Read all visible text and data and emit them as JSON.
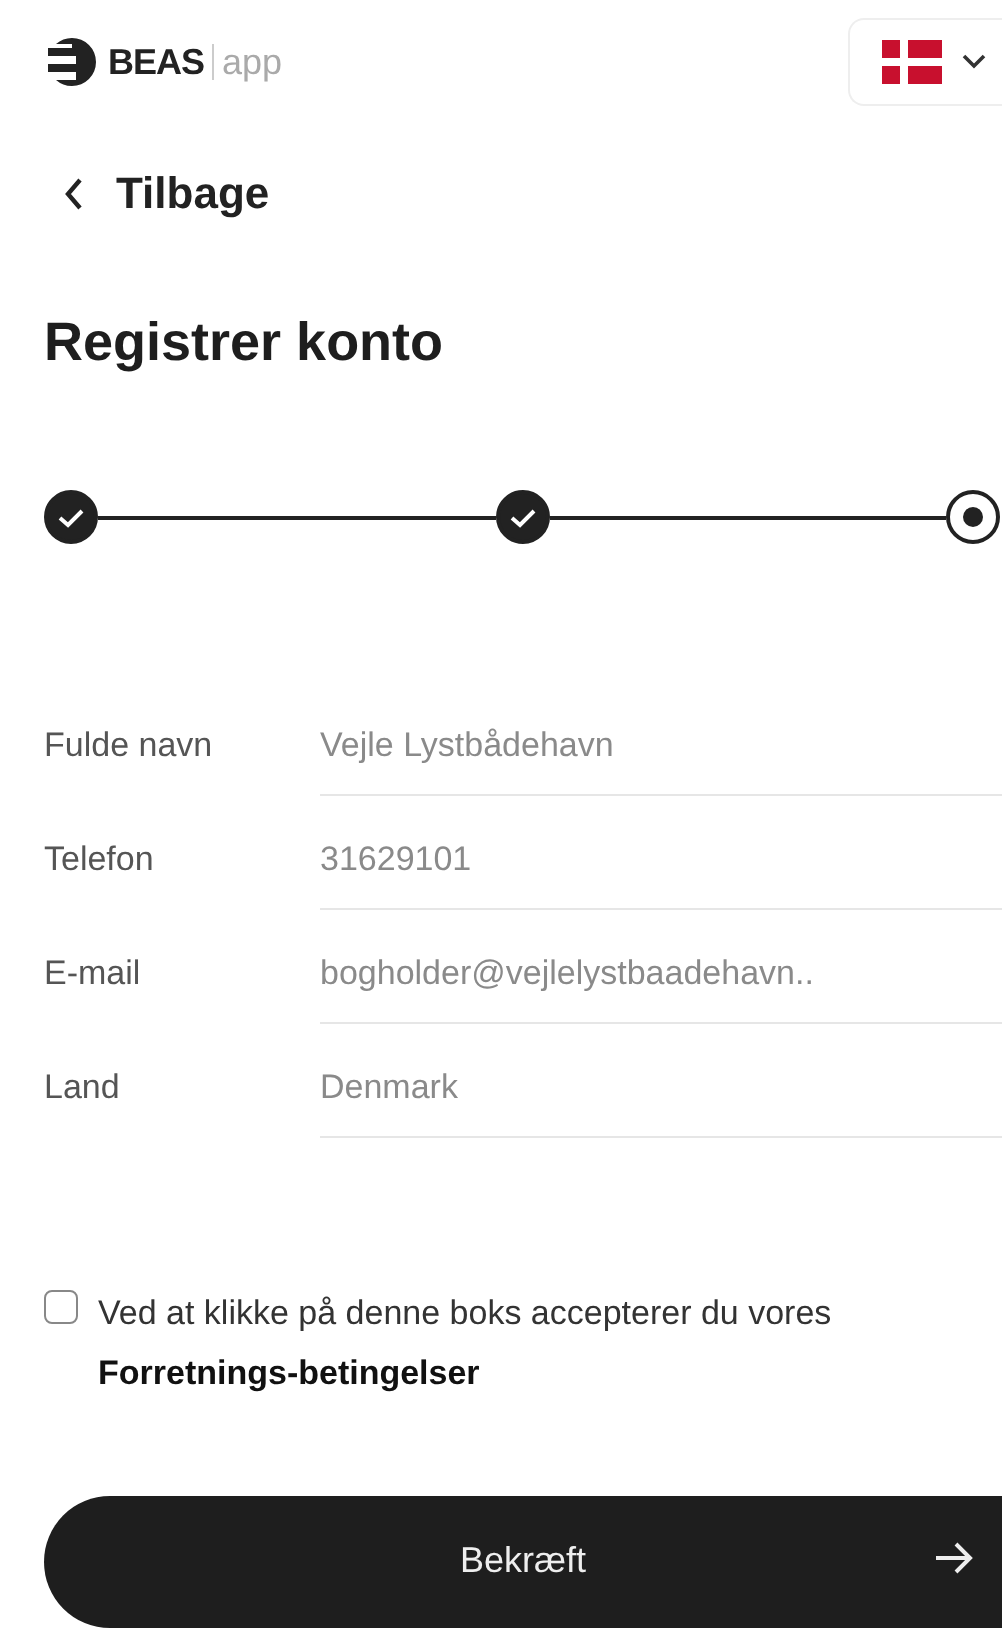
{
  "header": {
    "logo_text": "BEAS",
    "logo_suffix": "app"
  },
  "back": {
    "label": "Tilbage"
  },
  "title": "Registrer konto",
  "stepper": [
    {
      "completed": true,
      "selected": false
    },
    {
      "completed": true,
      "selected": false
    },
    {
      "completed": false,
      "selected": true
    }
  ],
  "fields": [
    {
      "label": "Fulde navn",
      "value": "Vejle Lystbådehavn"
    },
    {
      "label": "Telefon",
      "value": "31629101"
    },
    {
      "label": "E-mail",
      "value": "bogholder@vejlelystbaadehavn.."
    },
    {
      "label": "Land",
      "value": "Denmark"
    }
  ],
  "terms": {
    "checked": false,
    "text": "Ved at klikke på denne boks accepterer du vores **Forretnings-betingelser**"
  },
  "submit": {
    "label": "Bekræft"
  }
}
